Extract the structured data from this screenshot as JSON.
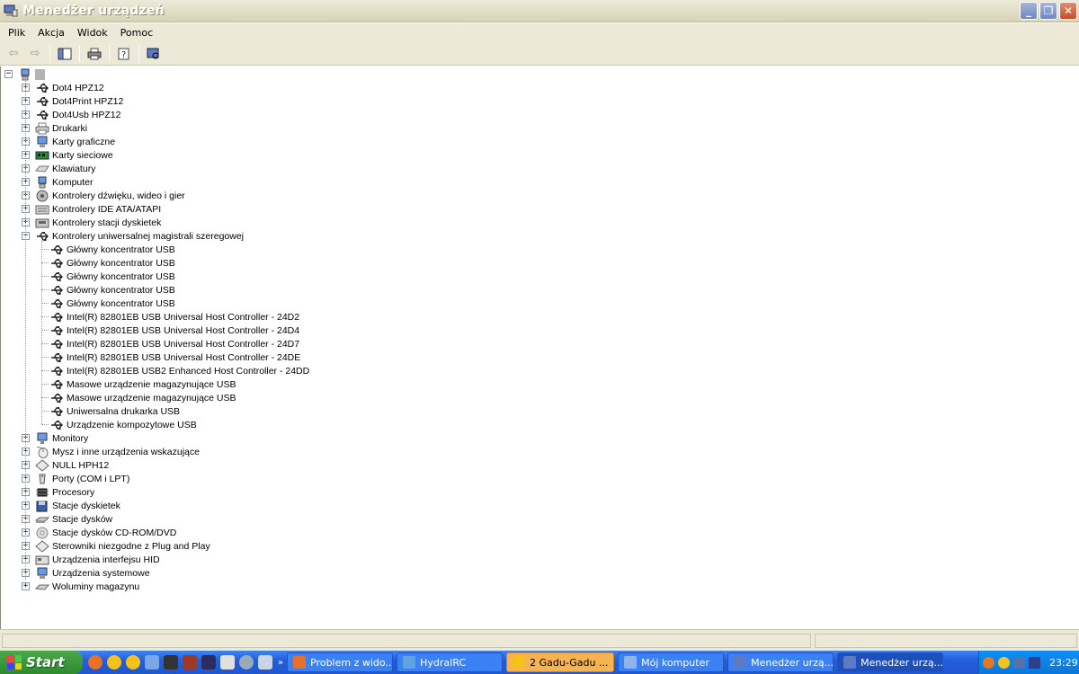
{
  "window": {
    "title": "Menedżer urządzeń"
  },
  "menu": [
    "Plik",
    "Akcja",
    "Widok",
    "Pomoc"
  ],
  "toolbar": {
    "icons": [
      "back-arrow-icon",
      "forward-arrow-icon",
      "properties-view-icon",
      "print-icon",
      "help-icon",
      "scan-hardware-icon"
    ]
  },
  "tree": {
    "root": "",
    "categories": [
      {
        "label": "Dot4 HPZ12",
        "icon": "usb-icon",
        "expanded": false
      },
      {
        "label": "Dot4Print HPZ12",
        "icon": "usb-icon",
        "expanded": false
      },
      {
        "label": "Dot4Usb HPZ12",
        "icon": "usb-icon",
        "expanded": false
      },
      {
        "label": "Drukarki",
        "icon": "printer-icon",
        "expanded": false
      },
      {
        "label": "Karty graficzne",
        "icon": "display-adapter-icon",
        "expanded": false
      },
      {
        "label": "Karty sieciowe",
        "icon": "network-card-icon",
        "expanded": false
      },
      {
        "label": "Klawiatury",
        "icon": "keyboard-icon",
        "expanded": false
      },
      {
        "label": "Komputer",
        "icon": "computer-icon",
        "expanded": false
      },
      {
        "label": "Kontrolery dźwięku, wideo i gier",
        "icon": "sound-icon",
        "expanded": false
      },
      {
        "label": "Kontrolery IDE ATA/ATAPI",
        "icon": "ide-icon",
        "expanded": false
      },
      {
        "label": "Kontrolery stacji dyskietek",
        "icon": "floppy-controller-icon",
        "expanded": false
      },
      {
        "label": "Kontrolery uniwersalnej magistrali szeregowej",
        "icon": "usb-icon",
        "expanded": true,
        "children": [
          "Główny koncentrator USB",
          "Główny koncentrator USB",
          "Główny koncentrator USB",
          "Główny koncentrator USB",
          "Główny koncentrator USB",
          "Intel(R) 82801EB USB Universal Host Controller - 24D2",
          "Intel(R) 82801EB USB Universal Host Controller - 24D4",
          "Intel(R) 82801EB USB Universal Host Controller - 24D7",
          "Intel(R) 82801EB USB Universal Host Controller - 24DE",
          "Intel(R) 82801EB USB2 Enhanced Host Controller - 24DD",
          "Masowe urządzenie magazynujące USB",
          "Masowe urządzenie magazynujące USB",
          "Uniwersalna drukarka USB",
          "Urządzenie kompozytowe USB"
        ]
      },
      {
        "label": "Monitory",
        "icon": "monitor-icon",
        "expanded": false
      },
      {
        "label": "Mysz i inne urządzenia wskazujące",
        "icon": "mouse-icon",
        "expanded": false
      },
      {
        "label": "NULL HPH12",
        "icon": "unknown-device-icon",
        "expanded": false
      },
      {
        "label": "Porty (COM i LPT)",
        "icon": "port-icon",
        "expanded": false
      },
      {
        "label": "Procesory",
        "icon": "processor-icon",
        "expanded": false
      },
      {
        "label": "Stacje dyskietek",
        "icon": "floppy-drive-icon",
        "expanded": false
      },
      {
        "label": "Stacje dysków",
        "icon": "disk-drive-icon",
        "expanded": false
      },
      {
        "label": "Stacje dysków CD-ROM/DVD",
        "icon": "cdrom-icon",
        "expanded": false
      },
      {
        "label": "Sterowniki niezgodne z Plug and Play",
        "icon": "unknown-device-icon",
        "expanded": false
      },
      {
        "label": "Urządzenia interfejsu HID",
        "icon": "hid-icon",
        "expanded": false
      },
      {
        "label": "Urządzenia systemowe",
        "icon": "system-device-icon",
        "expanded": false
      },
      {
        "label": "Woluminy magazynu",
        "icon": "volume-icon",
        "expanded": false
      }
    ]
  },
  "taskbar": {
    "start_label": "Start",
    "tasks": [
      {
        "label": "Problem z wido...",
        "icon": "firefox-icon"
      },
      {
        "label": "HydraIRC",
        "icon": "hydrairc-icon"
      },
      {
        "label": "2 Gadu-Gadu ...",
        "icon": "gadu-gadu-icon",
        "state": "flash"
      },
      {
        "label": "Mój komputer",
        "icon": "my-computer-icon"
      },
      {
        "label": "Menedżer urzą...",
        "icon": "device-manager-icon"
      },
      {
        "label": "Menedżer urzą...",
        "icon": "device-manager-icon",
        "state": "active"
      }
    ],
    "clock": "23:29"
  },
  "colors": {
    "titlebar": "#d6d3b8",
    "taskbar": "#245edb",
    "start": "#2e8a2e",
    "flash_task": "#f7b352"
  }
}
